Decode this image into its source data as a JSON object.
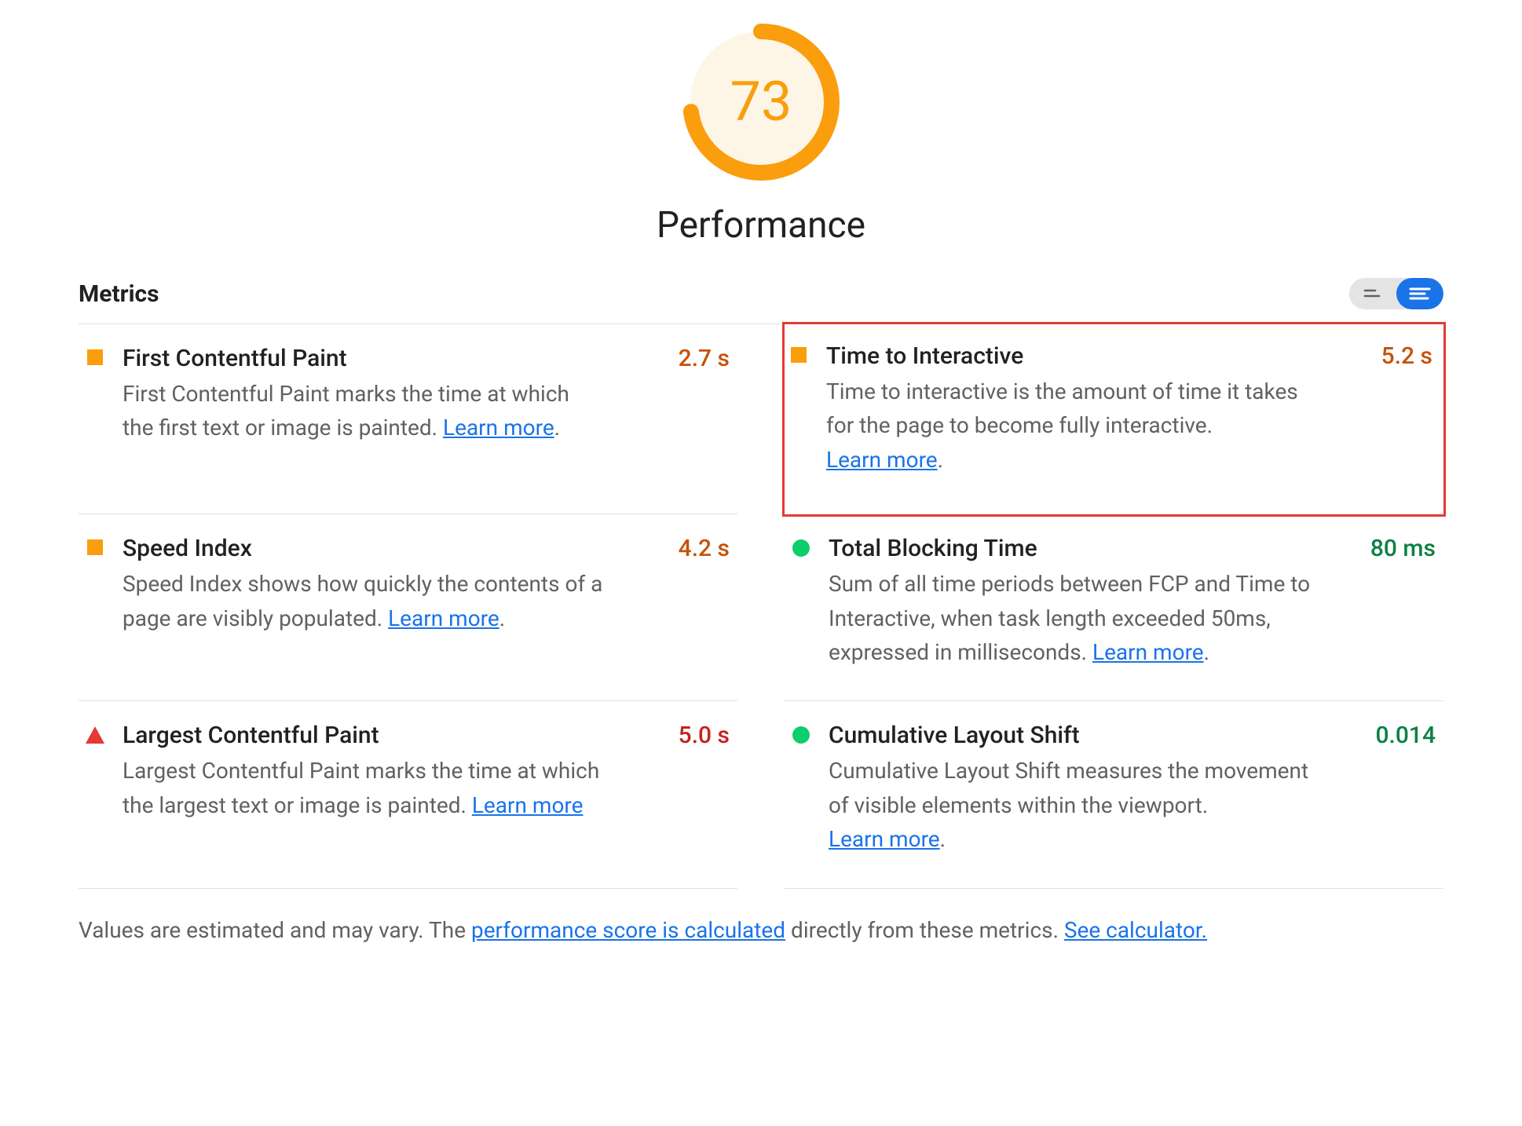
{
  "gauge": {
    "score": "73",
    "label": "Performance",
    "color": "#fa9e0d",
    "background_fill": "#fdf5e6"
  },
  "metrics_header": {
    "title": "Metrics"
  },
  "metrics": [
    {
      "id": "first-contentful-paint",
      "icon": "square-orange",
      "title": "First Contentful Paint",
      "description": "First Contentful Paint marks the time at which the first text or image is painted. ",
      "learn_more": "Learn more",
      "trailing_period": ".",
      "value": "2.7 s",
      "value_class": "orange",
      "highlight": false
    },
    {
      "id": "time-to-interactive",
      "icon": "square-orange",
      "title": "Time to Interactive",
      "description": "Time to interactive is the amount of time it takes for the page to become fully interactive. ",
      "learn_more": "Learn more",
      "trailing_period": ".",
      "value": "5.2 s",
      "value_class": "orange",
      "highlight": true
    },
    {
      "id": "speed-index",
      "icon": "square-orange",
      "title": "Speed Index",
      "description": "Speed Index shows how quickly the contents of a page are visibly populated. ",
      "learn_more": "Learn more",
      "trailing_period": ".",
      "value": "4.2 s",
      "value_class": "orange",
      "highlight": false
    },
    {
      "id": "total-blocking-time",
      "icon": "circle-green",
      "title": "Total Blocking Time",
      "description": "Sum of all time periods between FCP and Time to Interactive, when task length exceeded 50ms, expressed in milliseconds. ",
      "learn_more": "Learn more",
      "trailing_period": ".",
      "value": "80 ms",
      "value_class": "green",
      "highlight": false
    },
    {
      "id": "largest-contentful-paint",
      "icon": "triangle-red",
      "title": "Largest Contentful Paint",
      "description": "Largest Contentful Paint marks the time at which the largest text or image is painted. ",
      "learn_more": "Learn more",
      "trailing_period": "",
      "value": "5.0 s",
      "value_class": "red",
      "highlight": false
    },
    {
      "id": "cumulative-layout-shift",
      "icon": "circle-green",
      "title": "Cumulative Layout Shift",
      "description": "Cumulative Layout Shift measures the movement of visible elements within the viewport. ",
      "learn_more": "Learn more",
      "trailing_period": ".",
      "value": "0.014",
      "value_class": "green",
      "highlight": false
    }
  ],
  "footnote": {
    "prefix": "Values are estimated and may vary. The ",
    "link1": "performance score is calculated",
    "middle": " directly from these metrics. ",
    "link2": "See calculator."
  },
  "chart_data": {
    "type": "gauge",
    "title": "Performance",
    "value": 73,
    "range": [
      0,
      100
    ],
    "color": "#fa9e0d"
  }
}
